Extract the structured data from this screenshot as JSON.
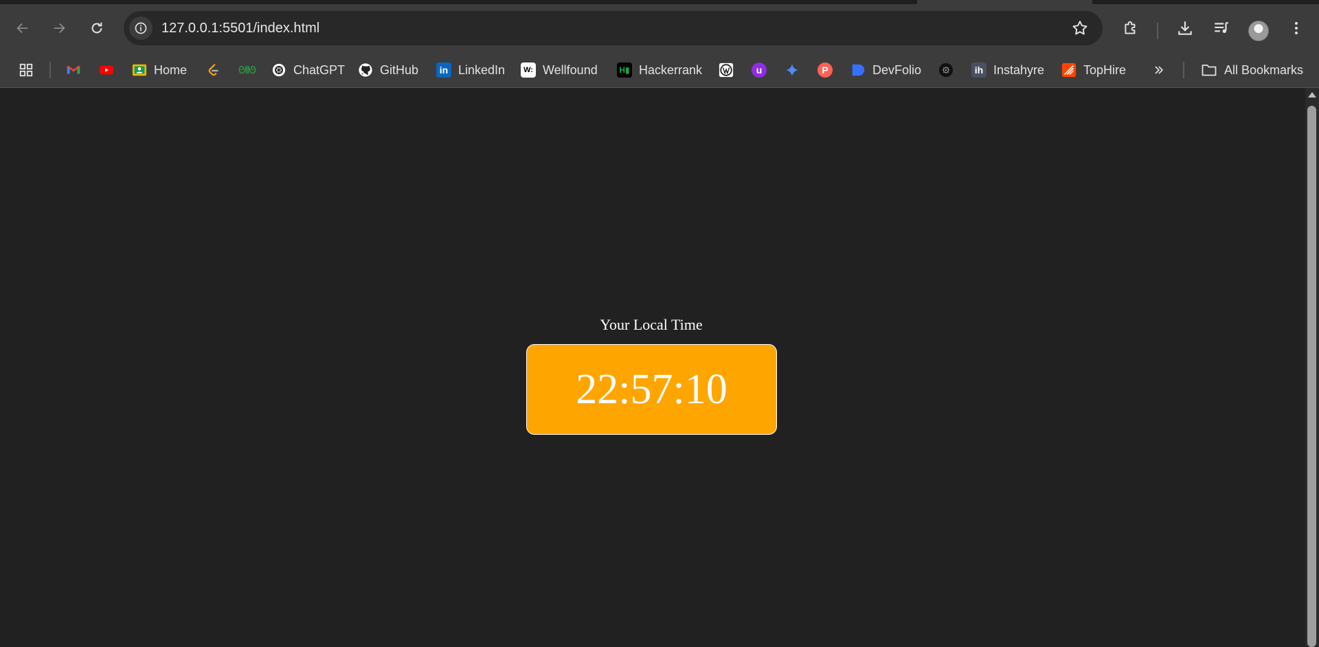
{
  "browser": {
    "url": "127.0.0.1:5501/index.html",
    "colors": {
      "chrome": "#3c3c3c",
      "omnibox": "#282828",
      "page_bg": "#212121"
    }
  },
  "bookmarks": {
    "items": [
      {
        "label": "",
        "icon": "gmail-icon",
        "color": "#ea4335"
      },
      {
        "label": "",
        "icon": "youtube-icon",
        "color": "#ff0000"
      },
      {
        "label": "Home",
        "icon": "classroom-icon",
        "color": "#f4b400"
      },
      {
        "label": "",
        "icon": "leetcode-icon",
        "color": "#ffa116"
      },
      {
        "label": "",
        "icon": "geeksforgeeks-icon",
        "color": "#2f8d46"
      },
      {
        "label": "ChatGPT",
        "icon": "chatgpt-icon",
        "color": "#ffffff"
      },
      {
        "label": "GitHub",
        "icon": "github-icon",
        "color": "#ffffff"
      },
      {
        "label": "LinkedIn",
        "icon": "linkedin-icon",
        "color": "#0a66c2"
      },
      {
        "label": "Wellfound",
        "icon": "wellfound-icon",
        "color": "#ffffff"
      },
      {
        "label": "Hackerrank",
        "icon": "hackerrank-icon",
        "color": "#1ba94c"
      },
      {
        "label": "",
        "icon": "wordpress-icon",
        "color": "#ffffff"
      },
      {
        "label": "",
        "icon": "unstop-icon",
        "color": "#8e2de2"
      },
      {
        "label": "",
        "icon": "gemini-icon",
        "color": "#4e8cf7"
      },
      {
        "label": "",
        "icon": "producthunt-icon",
        "color": "#ff6154"
      },
      {
        "label": "DevFolio",
        "icon": "devfolio-icon",
        "color": "#3770ff"
      },
      {
        "label": "",
        "icon": "dots-icon",
        "color": "#111111"
      },
      {
        "label": "Instahyre",
        "icon": "instahyre-icon",
        "color": "#4a4f63"
      },
      {
        "label": "TopHire",
        "icon": "tophire-icon",
        "color": "#ff4500"
      }
    ],
    "all_bookmarks": "All Bookmarks"
  },
  "page": {
    "heading": "Your Local Time",
    "time": "22:57:10",
    "clock_color": "#ffa500"
  }
}
